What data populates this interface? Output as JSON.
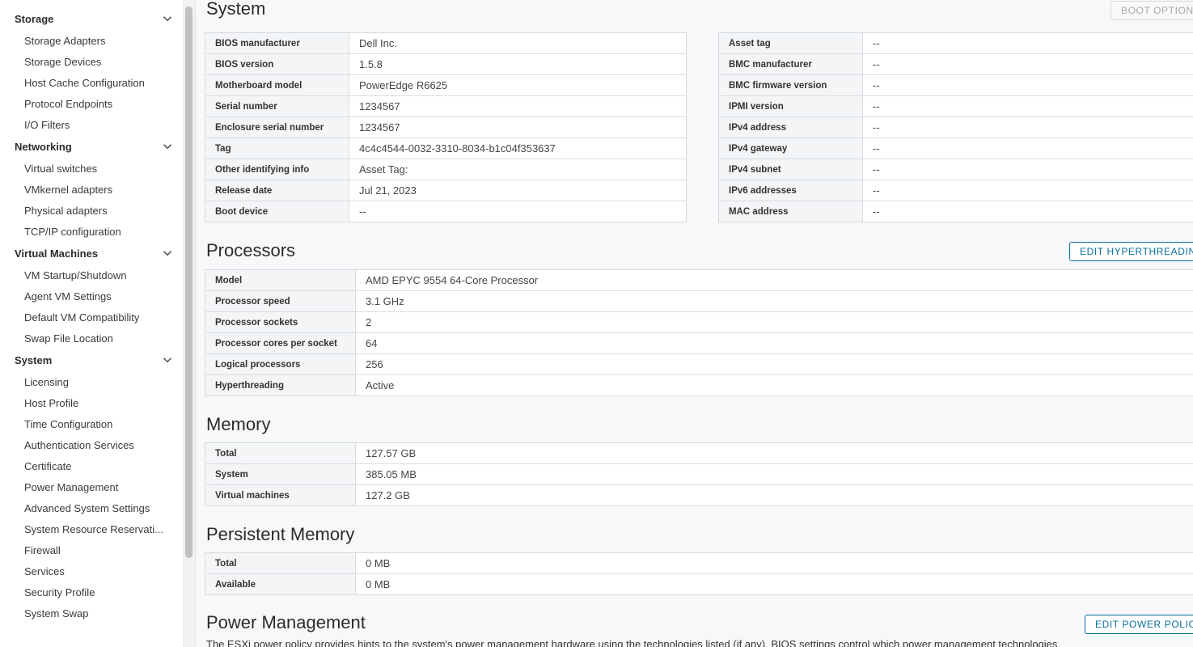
{
  "sidebar": {
    "groups": [
      {
        "label": "Storage",
        "items": [
          "Storage Adapters",
          "Storage Devices",
          "Host Cache Configuration",
          "Protocol Endpoints",
          "I/O Filters"
        ]
      },
      {
        "label": "Networking",
        "items": [
          "Virtual switches",
          "VMkernel adapters",
          "Physical adapters",
          "TCP/IP configuration"
        ]
      },
      {
        "label": "Virtual Machines",
        "items": [
          "VM Startup/Shutdown",
          "Agent VM Settings",
          "Default VM Compatibility",
          "Swap File Location"
        ]
      },
      {
        "label": "System",
        "items": [
          "Licensing",
          "Host Profile",
          "Time Configuration",
          "Authentication Services",
          "Certificate",
          "Power Management",
          "Advanced System Settings",
          "System Resource Reservati...",
          "Firewall",
          "Services",
          "Security Profile",
          "System Swap"
        ]
      }
    ]
  },
  "system": {
    "title": "System",
    "boot_options_label": "BOOT OPTIONS",
    "left_rows": [
      {
        "k": "BIOS manufacturer",
        "v": "Dell Inc."
      },
      {
        "k": "BIOS version",
        "v": "1.5.8"
      },
      {
        "k": "Motherboard model",
        "v": "PowerEdge R6625"
      },
      {
        "k": "Serial number",
        "v": "1234567"
      },
      {
        "k": "Enclosure serial number",
        "v": "1234567"
      },
      {
        "k": "Tag",
        "v": "4c4c4544-0032-3310-8034-b1c04f353637"
      },
      {
        "k": "Other identifying info",
        "v": "Asset Tag:"
      },
      {
        "k": "Release date",
        "v": "Jul 21, 2023"
      },
      {
        "k": "Boot device",
        "v": "--"
      }
    ],
    "right_rows": [
      {
        "k": "Asset tag",
        "v": "--"
      },
      {
        "k": "BMC manufacturer",
        "v": "--"
      },
      {
        "k": "BMC firmware version",
        "v": "--"
      },
      {
        "k": "IPMI version",
        "v": "--"
      },
      {
        "k": "IPv4 address",
        "v": "--"
      },
      {
        "k": "IPv4 gateway",
        "v": "--"
      },
      {
        "k": "IPv4 subnet",
        "v": "--"
      },
      {
        "k": "IPv6 addresses",
        "v": "--"
      },
      {
        "k": "MAC address",
        "v": "--"
      }
    ]
  },
  "processors": {
    "title": "Processors",
    "edit_label": "EDIT HYPERTHREADING",
    "rows": [
      {
        "k": "Model",
        "v": "AMD EPYC 9554 64-Core Processor"
      },
      {
        "k": "Processor speed",
        "v": "3.1 GHz"
      },
      {
        "k": "Processor sockets",
        "v": "2"
      },
      {
        "k": "Processor cores per socket",
        "v": "64"
      },
      {
        "k": "Logical processors",
        "v": "256"
      },
      {
        "k": "Hyperthreading",
        "v": "Active"
      }
    ]
  },
  "memory": {
    "title": "Memory",
    "rows": [
      {
        "k": "Total",
        "v": "127.57 GB"
      },
      {
        "k": "System",
        "v": "385.05 MB"
      },
      {
        "k": "Virtual machines",
        "v": "127.2 GB"
      }
    ]
  },
  "persistent_memory": {
    "title": "Persistent Memory",
    "rows": [
      {
        "k": "Total",
        "v": "0 MB"
      },
      {
        "k": "Available",
        "v": "0 MB"
      }
    ]
  },
  "power_management": {
    "title": "Power Management",
    "edit_label": "EDIT POWER POLICY",
    "description": "The ESXi power policy provides hints to the system's power management hardware using the technologies listed (if any). BIOS settings control which power management technologies"
  }
}
